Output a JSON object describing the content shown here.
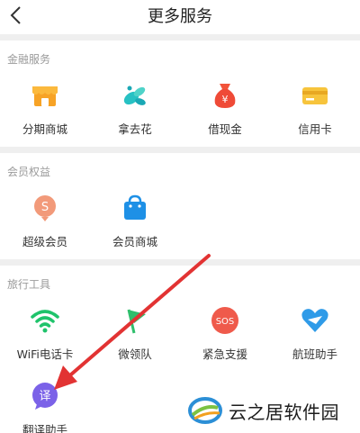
{
  "header": {
    "title": "更多服务"
  },
  "sections": [
    {
      "title": "金融服务",
      "items": [
        {
          "label": "分期商城",
          "icon": "store-icon"
        },
        {
          "label": "拿去花",
          "icon": "flower-icon"
        },
        {
          "label": "借现金",
          "icon": "money-bag-icon"
        },
        {
          "label": "信用卡",
          "icon": "credit-card-icon"
        }
      ]
    },
    {
      "title": "会员权益",
      "items": [
        {
          "label": "超级会员",
          "icon": "super-member-icon"
        },
        {
          "label": "会员商城",
          "icon": "member-mall-bag-icon"
        }
      ]
    },
    {
      "title": "旅行工具",
      "items": [
        {
          "label": "WiFi电话卡",
          "icon": "wifi-icon"
        },
        {
          "label": "微领队",
          "icon": "flag-icon"
        },
        {
          "label": "紧急支援",
          "icon": "sos-icon"
        },
        {
          "label": "航班助手",
          "icon": "flight-heart-icon"
        },
        {
          "label": "翻译助手",
          "icon": "translate-bubble-icon"
        }
      ]
    }
  ],
  "watermark": {
    "text": "云之居软件园"
  },
  "colors": {
    "background": "#ffffff",
    "separator": "#efefef",
    "arrow": "#e23333"
  }
}
